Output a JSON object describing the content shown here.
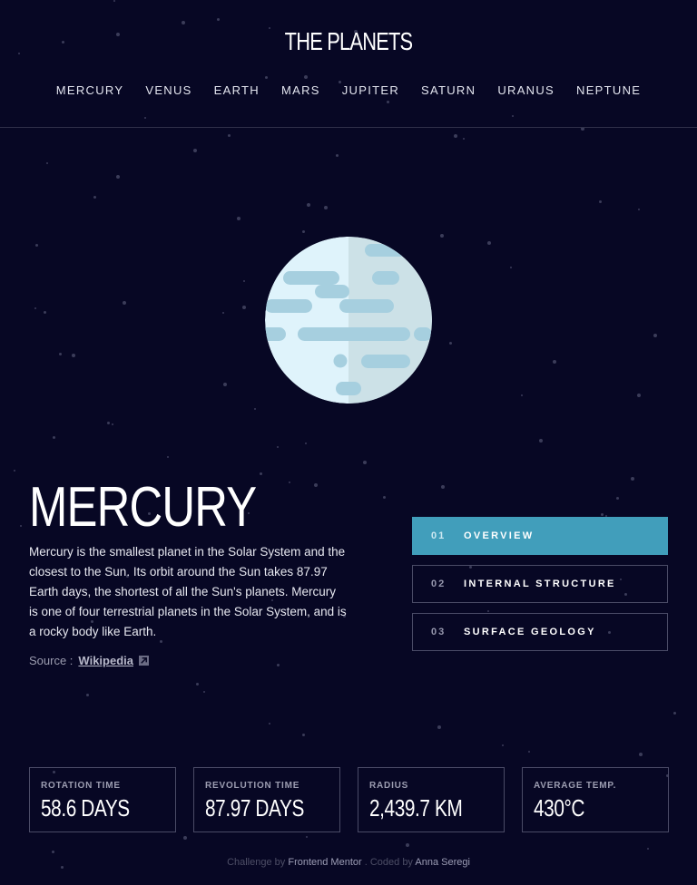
{
  "site": {
    "logo": "THE PLANETS"
  },
  "nav": [
    "MERCURY",
    "VENUS",
    "EARTH",
    "MARS",
    "JUPITER",
    "SATURN",
    "URANUS",
    "NEPTUNE"
  ],
  "planet": {
    "name": "MERCURY",
    "description": "Mercury is the smallest planet in the Solar System and the closest to the Sun. Its orbit around the Sun takes 87.97 Earth days, the shortest of all the Sun's planets. Mercury is one of four terrestrial planets in the Solar System, and is a rocky body like Earth.",
    "source_label": "Source :",
    "source_link": "Wikipedia",
    "source_icon": "external-link-icon"
  },
  "tabs": [
    {
      "num": "01",
      "label": "OVERVIEW",
      "active": true
    },
    {
      "num": "02",
      "label": "INTERNAL STRUCTURE",
      "active": false
    },
    {
      "num": "03",
      "label": "SURFACE GEOLOGY",
      "active": false
    }
  ],
  "stats": [
    {
      "label": "ROTATION TIME",
      "value": "58.6 DAYS"
    },
    {
      "label": "REVOLUTION TIME",
      "value": "87.97 DAYS"
    },
    {
      "label": "RADIUS",
      "value": "2,439.7 KM"
    },
    {
      "label": "AVERAGE TEMP.",
      "value": "430°C"
    }
  ],
  "footer": {
    "challenge_by": "Challenge by",
    "challenge_link": "Frontend Mentor",
    "coded_by": ". Coded by",
    "author_link": "Anna Seregi"
  },
  "colors": {
    "background": "#070724",
    "accent": "#419ebb",
    "planet_light": "#dff3fb",
    "planet_shadow": "#cce1e7",
    "planet_craters": "#a6cfdf"
  }
}
